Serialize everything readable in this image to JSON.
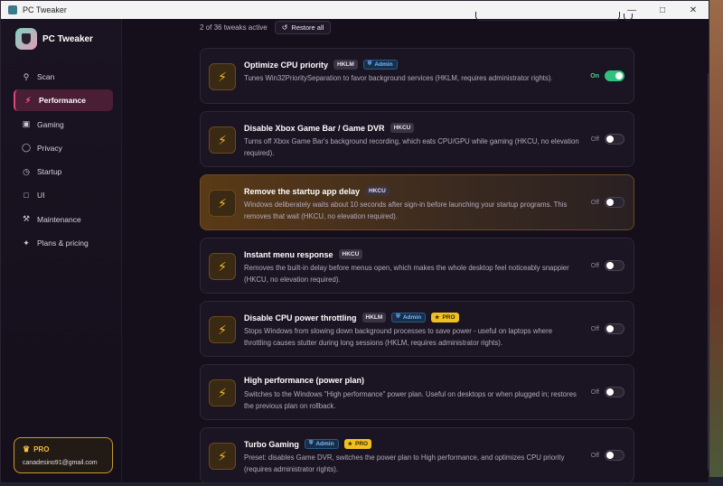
{
  "window": {
    "title": "PC Tweaker"
  },
  "brand": {
    "name": "PC Tweaker"
  },
  "sidebar": {
    "items": [
      {
        "label": "Scan",
        "icon": "search-icon"
      },
      {
        "label": "Performance",
        "icon": "bolt-icon",
        "active": true
      },
      {
        "label": "Gaming",
        "icon": "gamepad-icon"
      },
      {
        "label": "Privacy",
        "icon": "shield-icon"
      },
      {
        "label": "Startup",
        "icon": "clock-icon"
      },
      {
        "label": "UI",
        "icon": "window-icon"
      },
      {
        "label": "Maintenance",
        "icon": "wrench-icon"
      },
      {
        "label": "Plans & pricing",
        "icon": "sparkle-icon"
      }
    ],
    "pro": {
      "label": "PRO",
      "email": "canadesino91@gmail.com"
    }
  },
  "status": {
    "text": "2 of 36 tweaks active",
    "restore_label": "Restore all"
  },
  "tweaks": [
    {
      "title": "Optimize CPU priority",
      "badges": [
        "HKLM",
        "Admin"
      ],
      "desc": "Tunes Win32PrioritySeparation to favor background services (HKLM, requires administrator rights).",
      "state": "On"
    },
    {
      "title": "Disable Xbox Game Bar / Game DVR",
      "badges": [
        "HKCU"
      ],
      "desc": "Turns off Xbox Game Bar's background recording, which eats CPU/GPU while gaming (HKCU, no elevation required).",
      "state": "Off"
    },
    {
      "title": "Remove the startup app delay",
      "badges": [
        "HKCU"
      ],
      "desc": "Windows deliberately waits about 10 seconds after sign-in before launching your startup programs. This removes that wait (HKCU, no elevation required).",
      "state": "Off"
    },
    {
      "title": "Instant menu response",
      "badges": [
        "HKCU"
      ],
      "desc": "Removes the built-in delay before menus open, which makes the whole desktop feel noticeably snappier (HKCU, no elevation required).",
      "state": "Off"
    },
    {
      "title": "Disable CPU power throttling",
      "badges": [
        "HKLM",
        "Admin",
        "PRO"
      ],
      "desc": "Stops Windows from slowing down background processes to save power - useful on laptops where throttling causes stutter during long sessions (HKLM, requires administrator rights).",
      "state": "Off"
    },
    {
      "title": "High performance (power plan)",
      "badges": [],
      "desc": "Switches to the Windows \"High performance\" power plan. Useful on desktops or when plugged in; restores the previous plan on rollback.",
      "state": "Off"
    },
    {
      "title": "Turbo Gaming",
      "badges": [
        "Admin",
        "PRO"
      ],
      "desc": "Preset: disables Game DVR, switches the power plan to High performance, and optimizes CPU priority (requires administrator rights).",
      "state": "Off"
    }
  ],
  "colors": {
    "accent": "#e2457a",
    "toggle_on": "#2ec27e",
    "bolt": "#f5b82e",
    "pro": "#f0c020"
  }
}
